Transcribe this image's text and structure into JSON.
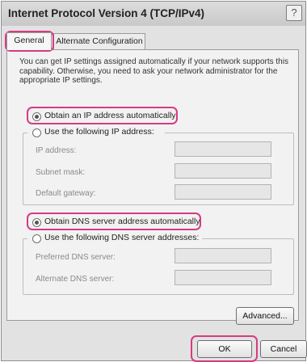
{
  "window": {
    "title": "Internet Protocol Version 4 (TCP/IPv4)",
    "help_symbol": "?"
  },
  "tabs": [
    {
      "label": "General",
      "selected": true
    },
    {
      "label": "Alternate Configuration",
      "selected": false
    }
  ],
  "intro_text": "You can get IP settings assigned automatically if your network supports this capability. Otherwise, you need to ask your network administrator for the appropriate IP settings.",
  "ip_section": {
    "auto_label": "Obtain an IP address automatically",
    "auto_selected": true,
    "manual_label": "Use the following IP address:",
    "manual_selected": false,
    "fields": [
      {
        "label": "IP address:",
        "value": ""
      },
      {
        "label": "Subnet mask:",
        "value": ""
      },
      {
        "label": "Default gateway:",
        "value": ""
      }
    ]
  },
  "dns_section": {
    "auto_label": "Obtain DNS server address automatically",
    "auto_selected": true,
    "manual_label": "Use the following DNS server addresses:",
    "manual_selected": false,
    "fields": [
      {
        "label": "Preferred DNS server:",
        "value": ""
      },
      {
        "label": "Alternate DNS server:",
        "value": ""
      }
    ]
  },
  "buttons": {
    "advanced": "Advanced...",
    "ok": "OK",
    "cancel": "Cancel"
  },
  "colors": {
    "highlight": "#d63b83",
    "window_bg": "#e2e2e2",
    "panel_bg": "#f2f2f2"
  }
}
